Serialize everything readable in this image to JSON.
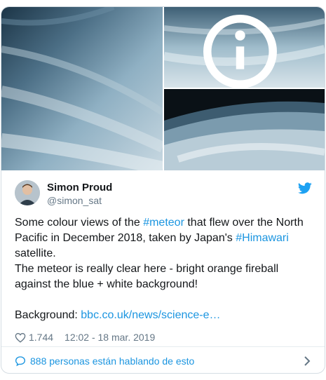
{
  "author": {
    "name": "Simon Proud",
    "handle": "@simon_sat"
  },
  "tweet": {
    "line1_pre": "Some colour views of the ",
    "hashtag1": "#meteor",
    "line1_mid": " that flew over the North Pacific in December 2018, taken by Japan's ",
    "hashtag2": "#Himawari",
    "line1_post": " satellite.",
    "line2": "The meteor is really clear here - bright orange fireball against the blue + white background!",
    "background_label": "Background: ",
    "background_link": "bbc.co.uk/news/science-e…"
  },
  "meta": {
    "likes": "1.744",
    "timestamp": "12:02 - 18 mar. 2019"
  },
  "footer": {
    "conversation": "888 personas están hablando de esto"
  },
  "colors": {
    "accent": "#1b95e0",
    "twitter_blue": "#1da1f2",
    "muted": "#657786",
    "border": "#e6ecf0"
  },
  "icons": [
    "info-icon",
    "twitter-bird-icon",
    "heart-icon",
    "speech-bubble-icon",
    "chevron-right-icon"
  ]
}
